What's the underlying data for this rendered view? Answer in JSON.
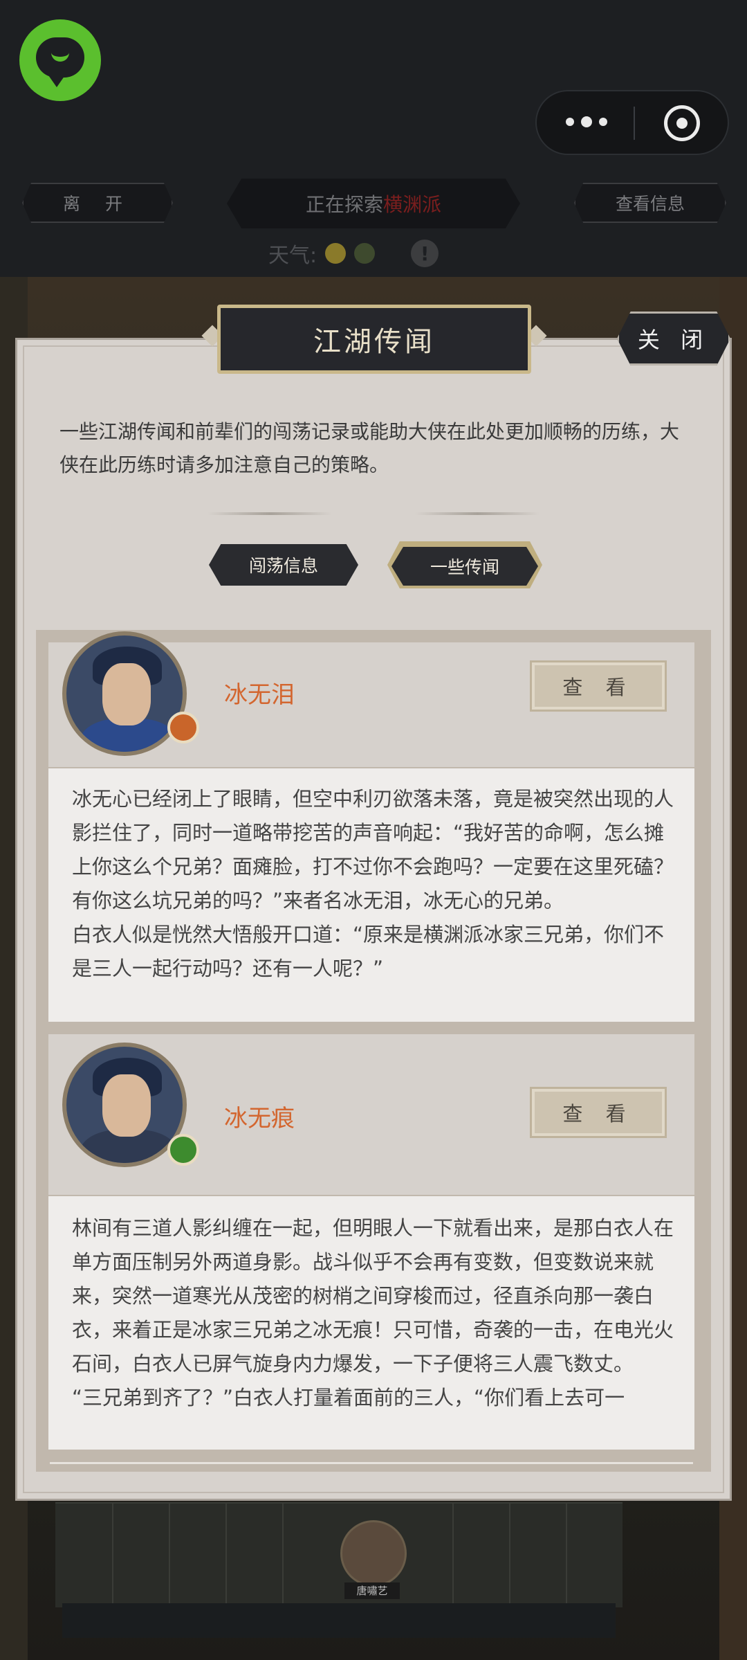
{
  "header": {
    "leave_label": "离 开",
    "explore_prefix": "正在探索",
    "explore_place": "横渊派",
    "info_label": "查看信息",
    "weather_label": "天气:"
  },
  "dialog": {
    "title": "江湖传闻",
    "close_label": "关 闭",
    "description": "一些江湖传闻和前辈们的闯荡记录或能助大侠在此处更加顺畅的历练，大侠在此历练时请多加注意自己的策略。",
    "tabs": [
      {
        "label": "闯荡信息",
        "active": false
      },
      {
        "label": "一些传闻",
        "active": true
      }
    ]
  },
  "entries": [
    {
      "name": "冰无泪",
      "view_label": "查 看",
      "badge_icon": "fire-element-icon",
      "text": "冰无心已经闭上了眼睛，但空中利刃欲落未落，竟是被突然出现的人影拦住了，同时一道略带挖苦的声音响起：“我好苦的命啊，怎么摊上你这么个兄弟？面瘫脸，打不过你不会跑吗？一定要在这里死磕？有你这么坑兄弟的吗？”来者名冰无泪，冰无心的兄弟。\n白衣人似是恍然大悟般开口道：“原来是横渊派冰家三兄弟，你们不是三人一起行动吗？还有一人呢？”"
    },
    {
      "name": "冰无痕",
      "view_label": "查 看",
      "badge_icon": "wind-element-icon",
      "text": "林间有三道人影纠缠在一起，但明眼人一下就看出来，是那白衣人在单方面压制另外两道身影。战斗似乎不会再有变数，但变数说来就来，突然一道寒光从茂密的树梢之间穿梭而过，径直杀向那一袭白衣，来着正是冰家三兄弟之冰无痕！只可惜，奇袭的一击，在电光火石间，白衣人已屏气旋身内力爆发，一下子便将三人震飞数丈。\n“三兄弟到齐了？”白衣人打量着面前的三人，“你们看上去可一"
    }
  ],
  "board": {
    "character_name": "唐嘯艺"
  },
  "colors": {
    "accent_name": "#d3662f",
    "place_red": "#7b1e1e",
    "logo_green": "#5bbf2e"
  }
}
